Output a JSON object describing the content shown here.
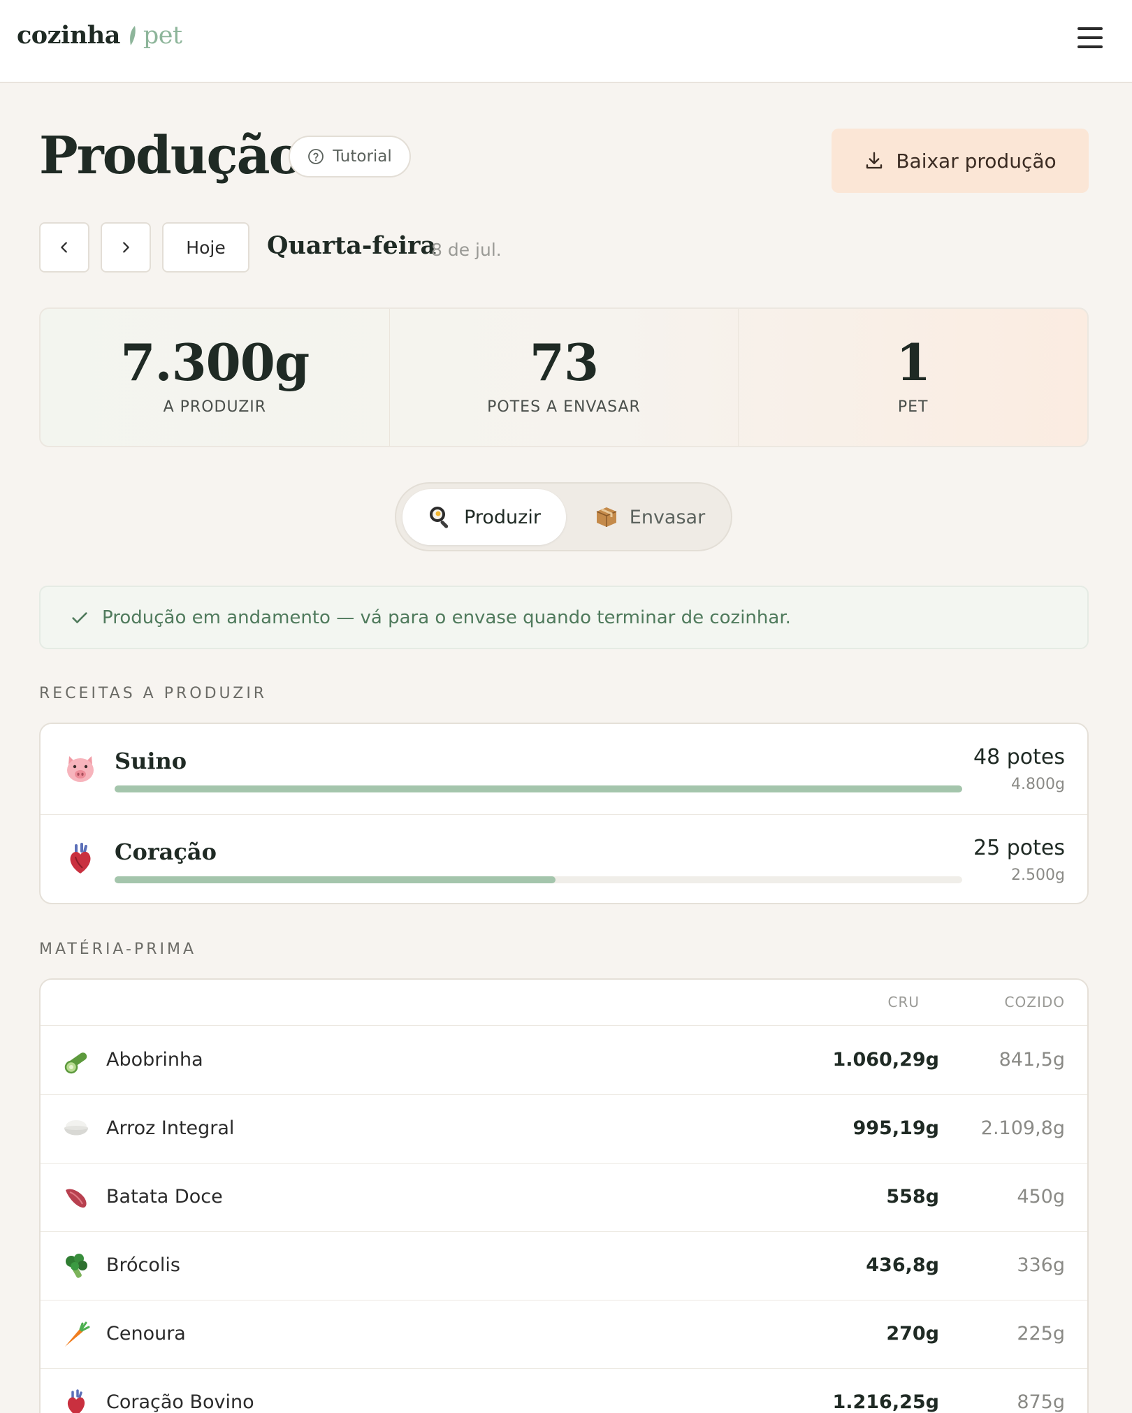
{
  "header": {
    "logo_word1": "cozinha",
    "logo_word2": "pet",
    "menu_icon": "hamburger-menu-icon"
  },
  "page": {
    "title": "Produção",
    "tutorial_label": "Tutorial",
    "download_label": "Baixar produção"
  },
  "date_nav": {
    "prev_icon": "chevron-left-icon",
    "next_icon": "chevron-right-icon",
    "today_label": "Hoje",
    "day_name": "Quarta-feira",
    "day_date": "8 de jul."
  },
  "stats": [
    {
      "value": "7.300g",
      "label": "A PRODUZIR"
    },
    {
      "value": "73",
      "label": "POTES A ENVASAR"
    },
    {
      "value": "1",
      "label": "PET"
    }
  ],
  "tabs": [
    {
      "label": "Produzir",
      "icon": "frying-pan-icon",
      "active": true
    },
    {
      "label": "Envasar",
      "icon": "package-icon",
      "active": false
    }
  ],
  "banner": {
    "icon": "check-icon",
    "text": "Produção em andamento — vá para o envase quando terminar de cozinhar."
  },
  "recipes_section": {
    "title": "RECEITAS A PRODUZIR",
    "items": [
      {
        "name": "Suino",
        "icon": "pig-face-icon",
        "count": "48 potes",
        "grams": "4.800g",
        "progress": 1.0
      },
      {
        "name": "Coração",
        "icon": "anatomical-heart-icon",
        "count": "25 potes",
        "grams": "2.500g",
        "progress": 0.52
      }
    ]
  },
  "materials_section": {
    "title": "MATÉRIA-PRIMA",
    "col_raw": "CRU",
    "col_cooked": "COZIDO",
    "rows": [
      {
        "name": "Abobrinha",
        "icon": "cucumber-icon",
        "raw": "1.060,29g",
        "cooked": "841,5g"
      },
      {
        "name": "Arroz Integral",
        "icon": "rice-bowl-icon",
        "raw": "995,19g",
        "cooked": "2.109,8g"
      },
      {
        "name": "Batata Doce",
        "icon": "sweet-potato-icon",
        "raw": "558g",
        "cooked": "450g"
      },
      {
        "name": "Brócolis",
        "icon": "broccoli-icon",
        "raw": "436,8g",
        "cooked": "336g"
      },
      {
        "name": "Cenoura",
        "icon": "carrot-icon",
        "raw": "270g",
        "cooked": "225g"
      },
      {
        "name": "Coração Bovino",
        "icon": "anatomical-heart-icon",
        "raw": "1.216,25g",
        "cooked": "875g"
      }
    ]
  },
  "colors": {
    "accent_green": "#a4c5ac",
    "logo_green": "#8db59a",
    "download_bg": "#fbe6d6",
    "banner_text": "#4f7a5c"
  }
}
